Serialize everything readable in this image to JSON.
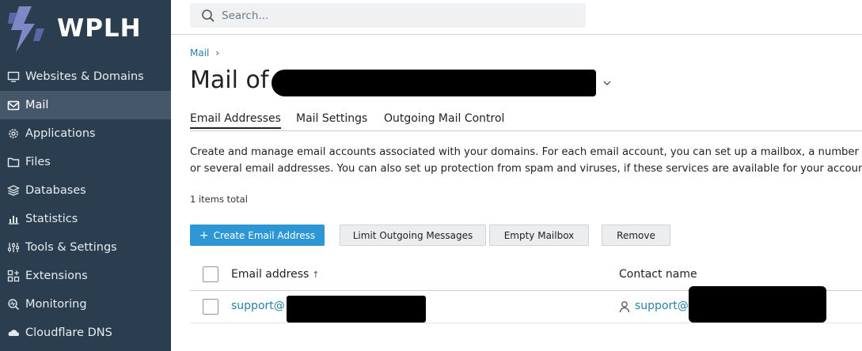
{
  "brand": {
    "name": "WPLH"
  },
  "search": {
    "placeholder": "Search..."
  },
  "sidebar": {
    "items": [
      {
        "label": "Websites & Domains",
        "icon": "monitor-icon"
      },
      {
        "label": "Mail",
        "icon": "envelope-icon",
        "active": true
      },
      {
        "label": "Applications",
        "icon": "gear-icon"
      },
      {
        "label": "Files",
        "icon": "folder-icon"
      },
      {
        "label": "Databases",
        "icon": "layers-icon"
      },
      {
        "label": "Statistics",
        "icon": "bar-chart-icon"
      },
      {
        "label": "Tools & Settings",
        "icon": "sliders-icon"
      },
      {
        "label": "Extensions",
        "icon": "extensions-icon"
      },
      {
        "label": "Monitoring",
        "icon": "monitoring-icon"
      },
      {
        "label": "Cloudflare DNS",
        "icon": "cloud-icon"
      }
    ]
  },
  "breadcrumb": {
    "item": "Mail",
    "separator": "›"
  },
  "page": {
    "title": "Mail of"
  },
  "tabs": [
    {
      "label": "Email Addresses",
      "active": true
    },
    {
      "label": "Mail Settings"
    },
    {
      "label": "Outgoing Mail Control"
    }
  ],
  "description": {
    "line1": "Create and manage email accounts associated with your domains. For each email account, you can set up a mailbox, a number of a",
    "line2": "or several email addresses. You can also set up protection from spam and viruses, if these services are available for your account."
  },
  "list": {
    "count_label": "1 items total"
  },
  "toolbar": {
    "create_label": "Create Email Address",
    "limit_label": "Limit Outgoing Messages",
    "empty_label": "Empty Mailbox",
    "remove_label": "Remove"
  },
  "table": {
    "columns": [
      "Email address",
      "Contact name"
    ],
    "sort_indicator": "↑",
    "rows": [
      {
        "email": "support@",
        "contact": "support@"
      }
    ]
  },
  "colors": {
    "sidebar_bg": "#2b3e4f",
    "sidebar_active": "#44586a",
    "primary_button": "#2d97d6",
    "link": "#2a7fa8"
  }
}
